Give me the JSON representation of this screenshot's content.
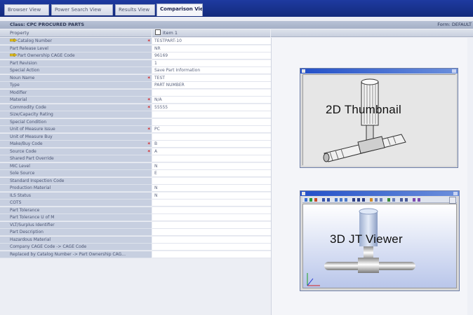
{
  "tabs": [
    {
      "label": "Browser View",
      "active": false
    },
    {
      "label": "Power Search View",
      "active": false
    },
    {
      "label": "Results View",
      "active": false
    },
    {
      "label": "Comparison View",
      "active": true
    }
  ],
  "header": {
    "class_label": "Class: CPC PROCURED PARTS",
    "form_label": "Form: DEFAULT",
    "property_header": "Property",
    "item_header": "Item 1"
  },
  "rows": [
    {
      "property": "Catalog Number",
      "value": "TESTPART-10",
      "required": true,
      "arrow": true
    },
    {
      "property": "Part Release Level",
      "value": "NR",
      "required": false
    },
    {
      "property": "Part Ownership CAGE Code",
      "value": "96169",
      "required": false,
      "arrow": true
    },
    {
      "property": "Part Revision",
      "value": "1",
      "required": false
    },
    {
      "property": "Special Action",
      "value": "Save Part Information",
      "required": false
    },
    {
      "property": "Noun Name",
      "value": "TEST",
      "required": true
    },
    {
      "property": "Type",
      "value": "PART NUMBER",
      "required": false
    },
    {
      "property": "Modifier",
      "value": "",
      "required": false
    },
    {
      "property": "Material",
      "value": "N/A",
      "required": true
    },
    {
      "property": "Commodity Code",
      "value": "55555",
      "required": true
    },
    {
      "property": "Size/Capacity Rating",
      "value": "",
      "required": false
    },
    {
      "property": "Special Condition",
      "value": "",
      "required": false
    },
    {
      "property": "Unit of Measure Issue",
      "value": "PC",
      "required": true
    },
    {
      "property": "Unit of Measure Buy",
      "value": "",
      "required": false
    },
    {
      "property": "Make/Buy Code",
      "value": "B",
      "required": true
    },
    {
      "property": "Source Code",
      "value": "A",
      "required": true
    },
    {
      "property": "Shared Part Override",
      "value": "",
      "required": false
    },
    {
      "property": "MIC Level",
      "value": "N",
      "required": false
    },
    {
      "property": "Sole Source",
      "value": "E",
      "required": false
    },
    {
      "property": "Standard Inspection Code",
      "value": "",
      "required": false
    },
    {
      "property": "Production Material",
      "value": "N",
      "required": false
    },
    {
      "property": "ILS Status",
      "value": "N",
      "required": false
    },
    {
      "property": "COTS",
      "value": "",
      "required": false
    },
    {
      "property": "Part Tolerance",
      "value": "",
      "required": false
    },
    {
      "property": "Part Tolerance U of M",
      "value": "",
      "required": false
    },
    {
      "property": "VLT/Surplus Identifier",
      "value": "",
      "required": false
    },
    {
      "property": "Part Description",
      "value": "",
      "required": false
    },
    {
      "property": "Hazardous Material",
      "value": "",
      "required": false
    },
    {
      "property": "Company CAGE Code -> CAGE Code",
      "value": "",
      "required": false
    },
    {
      "property": "Replaced by Catalog Number -> Part Ownership CAG...",
      "value": "",
      "required": false
    }
  ],
  "thumbnail": {
    "label": "2D Thumbnail"
  },
  "viewer": {
    "label": "3D JT Viewer"
  },
  "colors": {
    "required_marker": "#d21f1f",
    "tab_bar": "#1e3aa0",
    "property_cell": "#c7cfe0"
  },
  "icons": {
    "catalog_arrow": "arrow-icon",
    "close_tab": "close-tab-icon",
    "item_checkbox": "checkbox-icon"
  }
}
